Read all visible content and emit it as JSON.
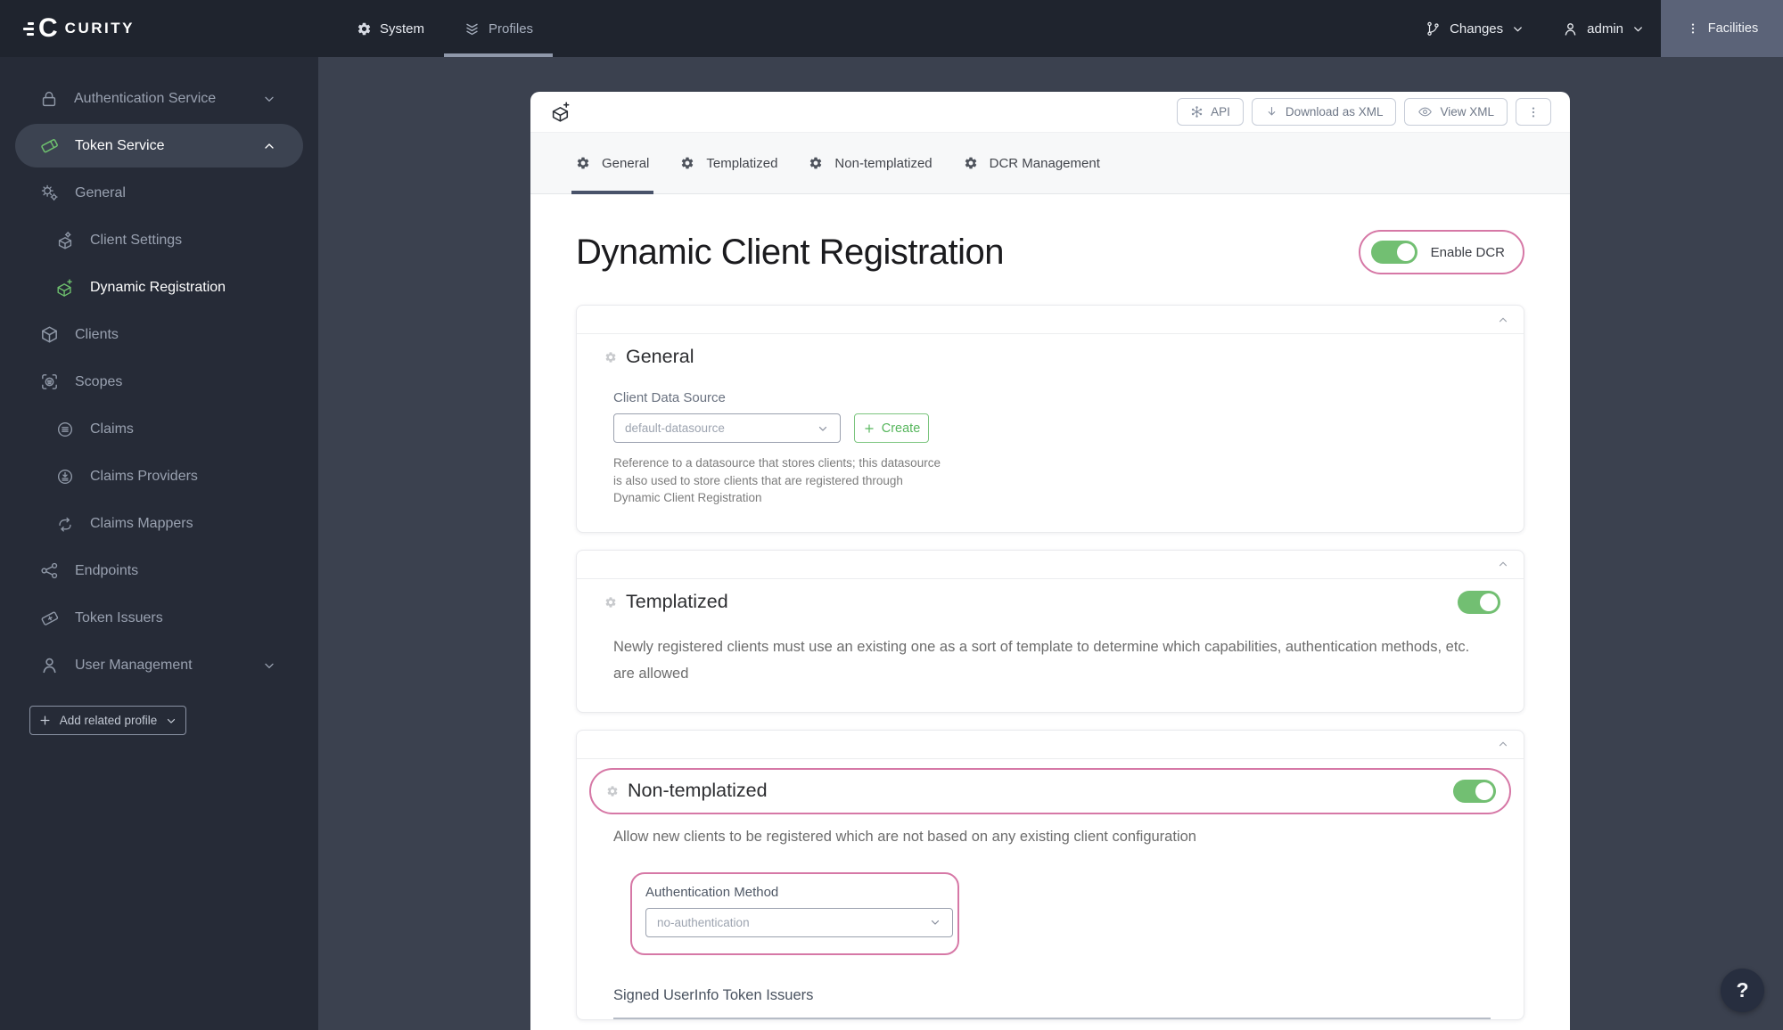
{
  "topbar": {
    "logo": "CURITY",
    "system_tab": "System",
    "profiles_tab": "Profiles",
    "changes": "Changes",
    "user": "admin",
    "facilities": "Facilities"
  },
  "sidebar": {
    "items": [
      {
        "label": "Authentication Service"
      },
      {
        "label": "Token Service"
      },
      {
        "label": "General"
      },
      {
        "label": "Client Settings"
      },
      {
        "label": "Dynamic Registration"
      },
      {
        "label": "Clients"
      },
      {
        "label": "Scopes"
      },
      {
        "label": "Claims"
      },
      {
        "label": "Claims Providers"
      },
      {
        "label": "Claims Mappers"
      },
      {
        "label": "Endpoints"
      },
      {
        "label": "Token Issuers"
      },
      {
        "label": "User Management"
      }
    ],
    "add_related_profile": "Add related profile"
  },
  "toolbar": {
    "api": "API",
    "download_xml": "Download as XML",
    "view_xml": "View XML"
  },
  "tabs": [
    {
      "label": "General"
    },
    {
      "label": "Templatized"
    },
    {
      "label": "Non-templatized"
    },
    {
      "label": "DCR Management"
    }
  ],
  "page": {
    "title": "Dynamic Client Registration",
    "enable_dcr": "Enable DCR",
    "help_button": "?"
  },
  "sections": {
    "general": {
      "heading": "General",
      "client_data_source_label": "Client Data Source",
      "client_data_source_value": "default-datasource",
      "create_button": "Create",
      "help_text": "Reference to a datasource that stores clients; this datasource\nis also used to store clients that are registered through\nDynamic Client Registration"
    },
    "templatized": {
      "heading": "Templatized",
      "description": "Newly registered clients must use an existing one as a sort of template to determine which capabilities, authentication methods, etc.\nare allowed",
      "enabled": true
    },
    "non_templatized": {
      "heading": "Non-templatized",
      "description": "Allow new clients to be registered which are not based on any existing client configuration",
      "enabled": true,
      "auth_method_label": "Authentication Method",
      "auth_method_value": "no-authentication",
      "signed_userinfo_label": "Signed UserInfo Token Issuers"
    }
  },
  "colors": {
    "green": "#72BF72",
    "pink": "#D678A6",
    "topbar_bg": "#1F242E",
    "sidebar_bg": "#262B37",
    "content_bg": "#3B414F"
  }
}
